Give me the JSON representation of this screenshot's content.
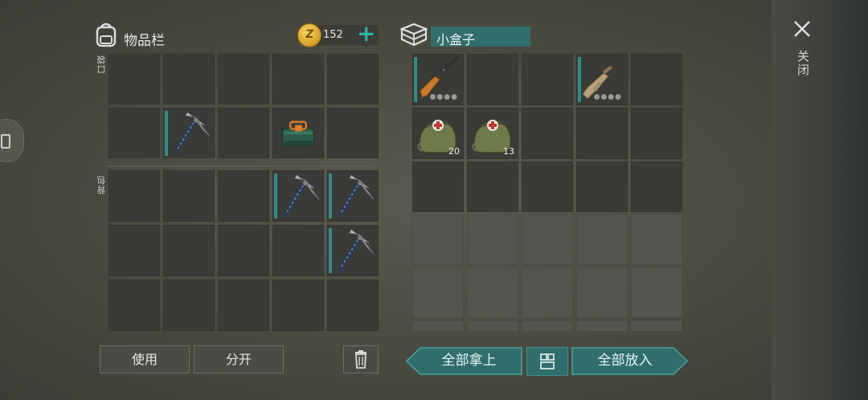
{
  "inventory": {
    "title": "物品栏",
    "coins": "152",
    "coin_letter": "Z",
    "pocket_label": "口袋",
    "backpack_label": "背包",
    "pocket_rows": [
      [
        "",
        "",
        "",
        "",
        ""
      ],
      [
        "",
        "pickaxe",
        "",
        "toolbox",
        ""
      ]
    ],
    "backpack_rows": [
      [
        "",
        "",
        "",
        "pickaxe",
        "pickaxe"
      ],
      [
        "",
        "",
        "",
        "",
        "pickaxe"
      ],
      [
        "",
        "",
        "",
        "",
        ""
      ]
    ],
    "use_button": "使用",
    "split_button": "分开"
  },
  "container": {
    "name": "小盒子",
    "rows": [
      [
        {
          "item": "rifle"
        },
        {
          "item": ""
        },
        {
          "item": ""
        },
        {
          "item": "assault-rifle"
        },
        {
          "item": ""
        }
      ],
      [
        {
          "item": "medkit",
          "count": "20"
        },
        {
          "item": "medkit",
          "count": "13"
        },
        {
          "item": ""
        },
        {
          "item": ""
        },
        {
          "item": ""
        }
      ],
      [
        {
          "item": ""
        },
        {
          "item": ""
        },
        {
          "item": ""
        },
        {
          "item": ""
        },
        {
          "item": ""
        }
      ]
    ],
    "locked_rows": 3,
    "take_all_button": "全部拿上",
    "put_all_button": "全部放入"
  },
  "close_label": "关闭",
  "colors": {
    "accent": "#2f6e6b",
    "accent_light": "#2fb3a6",
    "durability": "#2f8d88",
    "coin": "#e0b038"
  }
}
